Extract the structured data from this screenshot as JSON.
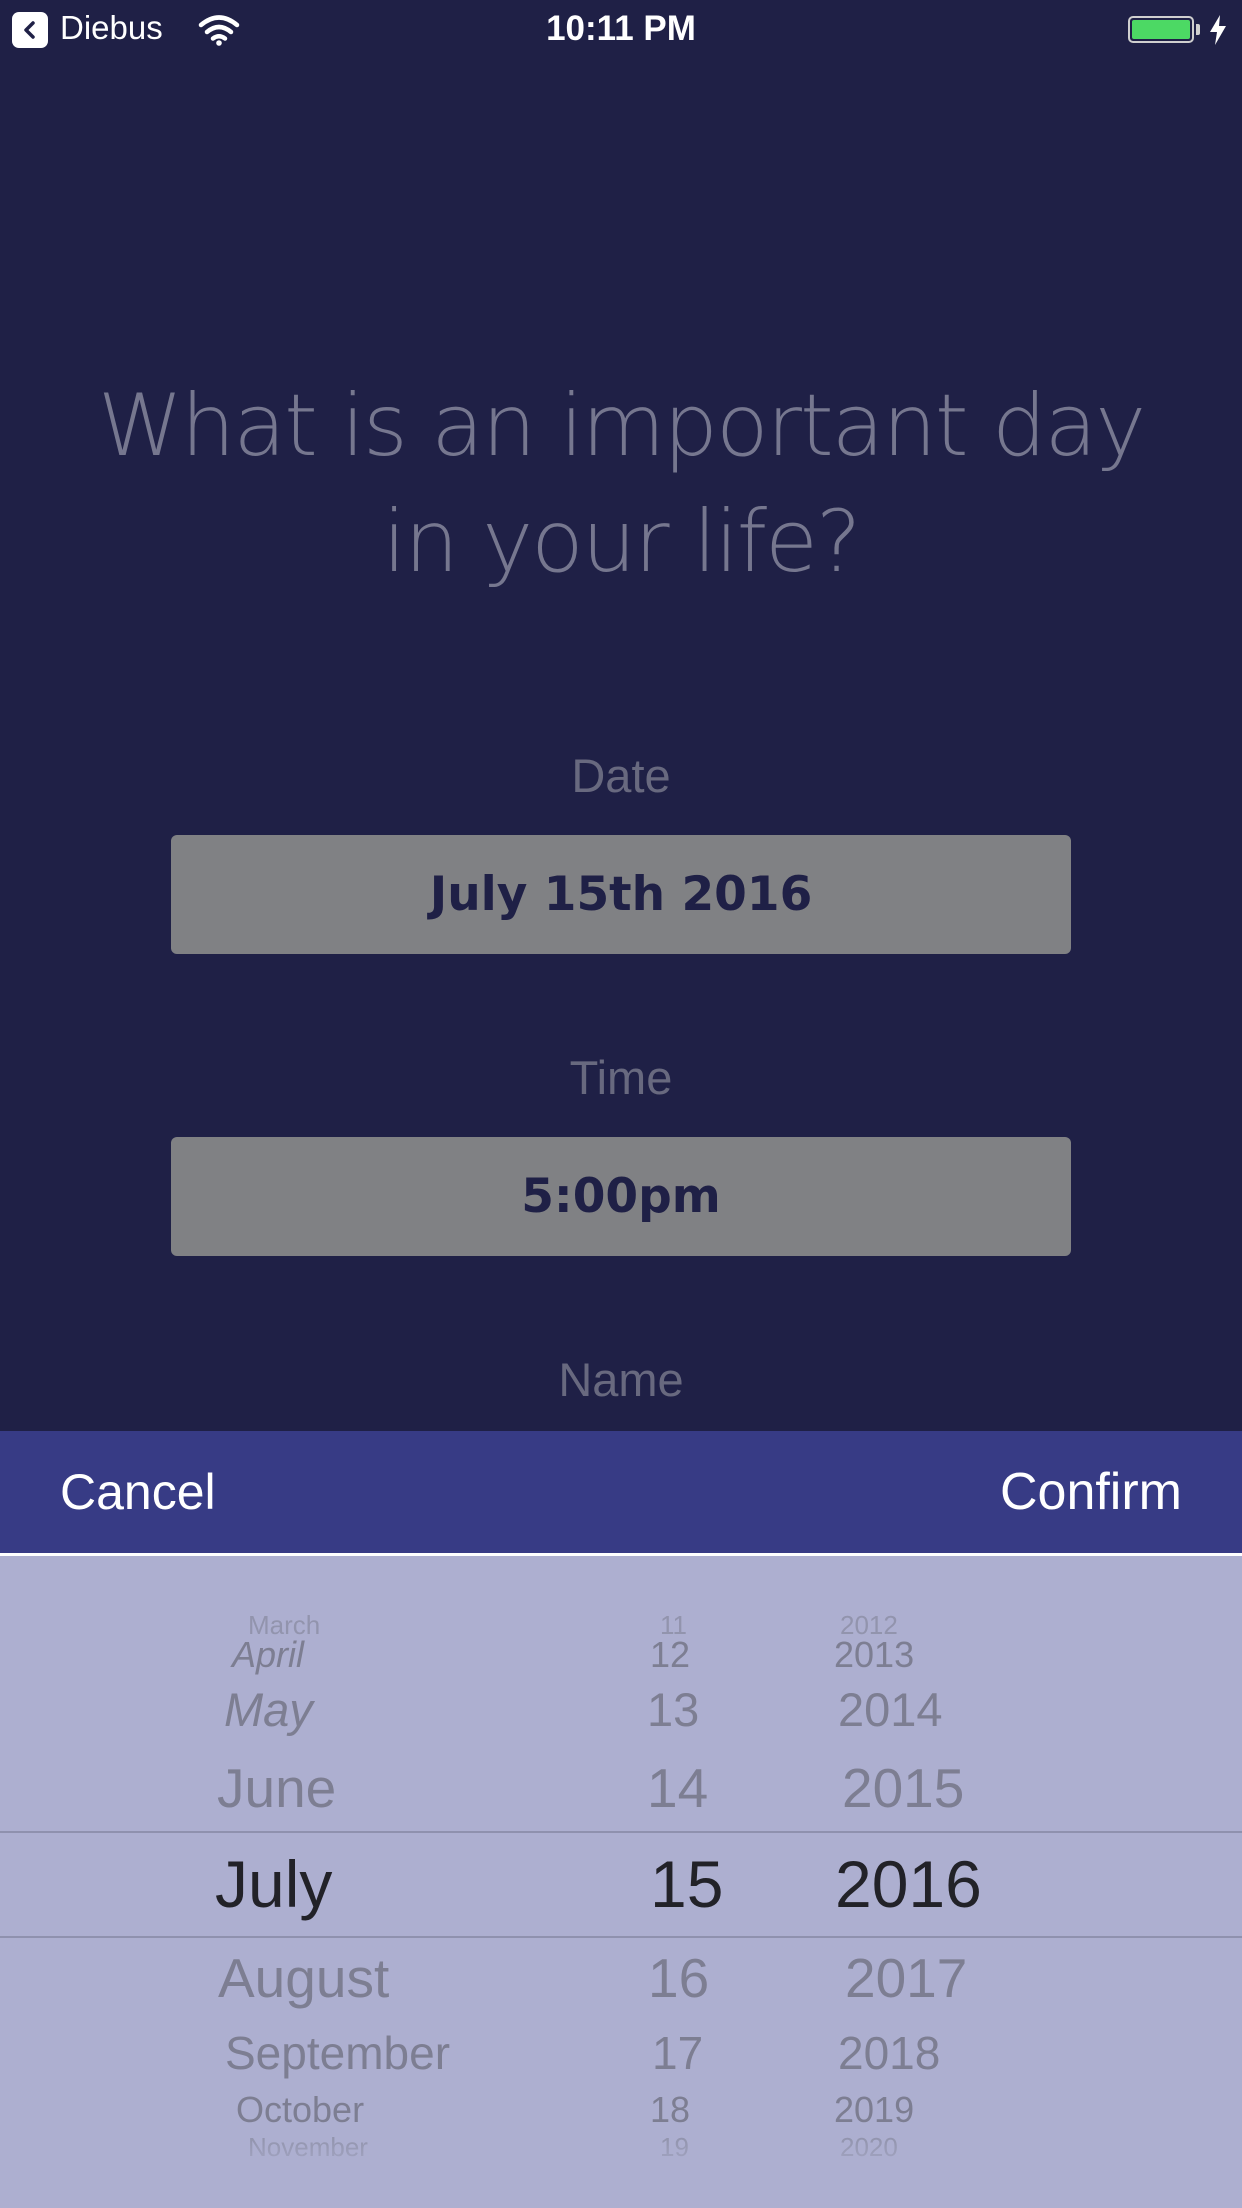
{
  "status_bar": {
    "back_app": "Diebus",
    "time": "10:11 PM",
    "battery_color": "#4cd964"
  },
  "question": "What is an important day in your life?",
  "fields": {
    "date_label": "Date",
    "date_value": "July 15th 2016",
    "time_label": "Time",
    "time_value": "5:00pm",
    "name_label": "Name"
  },
  "picker_toolbar": {
    "cancel_label": "Cancel",
    "confirm_label": "Confirm",
    "background": "#373b85"
  },
  "date_picker": {
    "months": [
      "March",
      "April",
      "May",
      "June",
      "July",
      "August",
      "September",
      "October",
      "November"
    ],
    "days": [
      "11",
      "12",
      "13",
      "14",
      "15",
      "16",
      "17",
      "18",
      "19"
    ],
    "years": [
      "2012",
      "2013",
      "2014",
      "2015",
      "2016",
      "2017",
      "2018",
      "2019",
      "2020"
    ],
    "selected": {
      "month": "July",
      "day": "15",
      "year": "2016"
    }
  },
  "colors": {
    "background": "#1f2046",
    "field_box": "#808184",
    "picker_background": "#adafd0"
  }
}
